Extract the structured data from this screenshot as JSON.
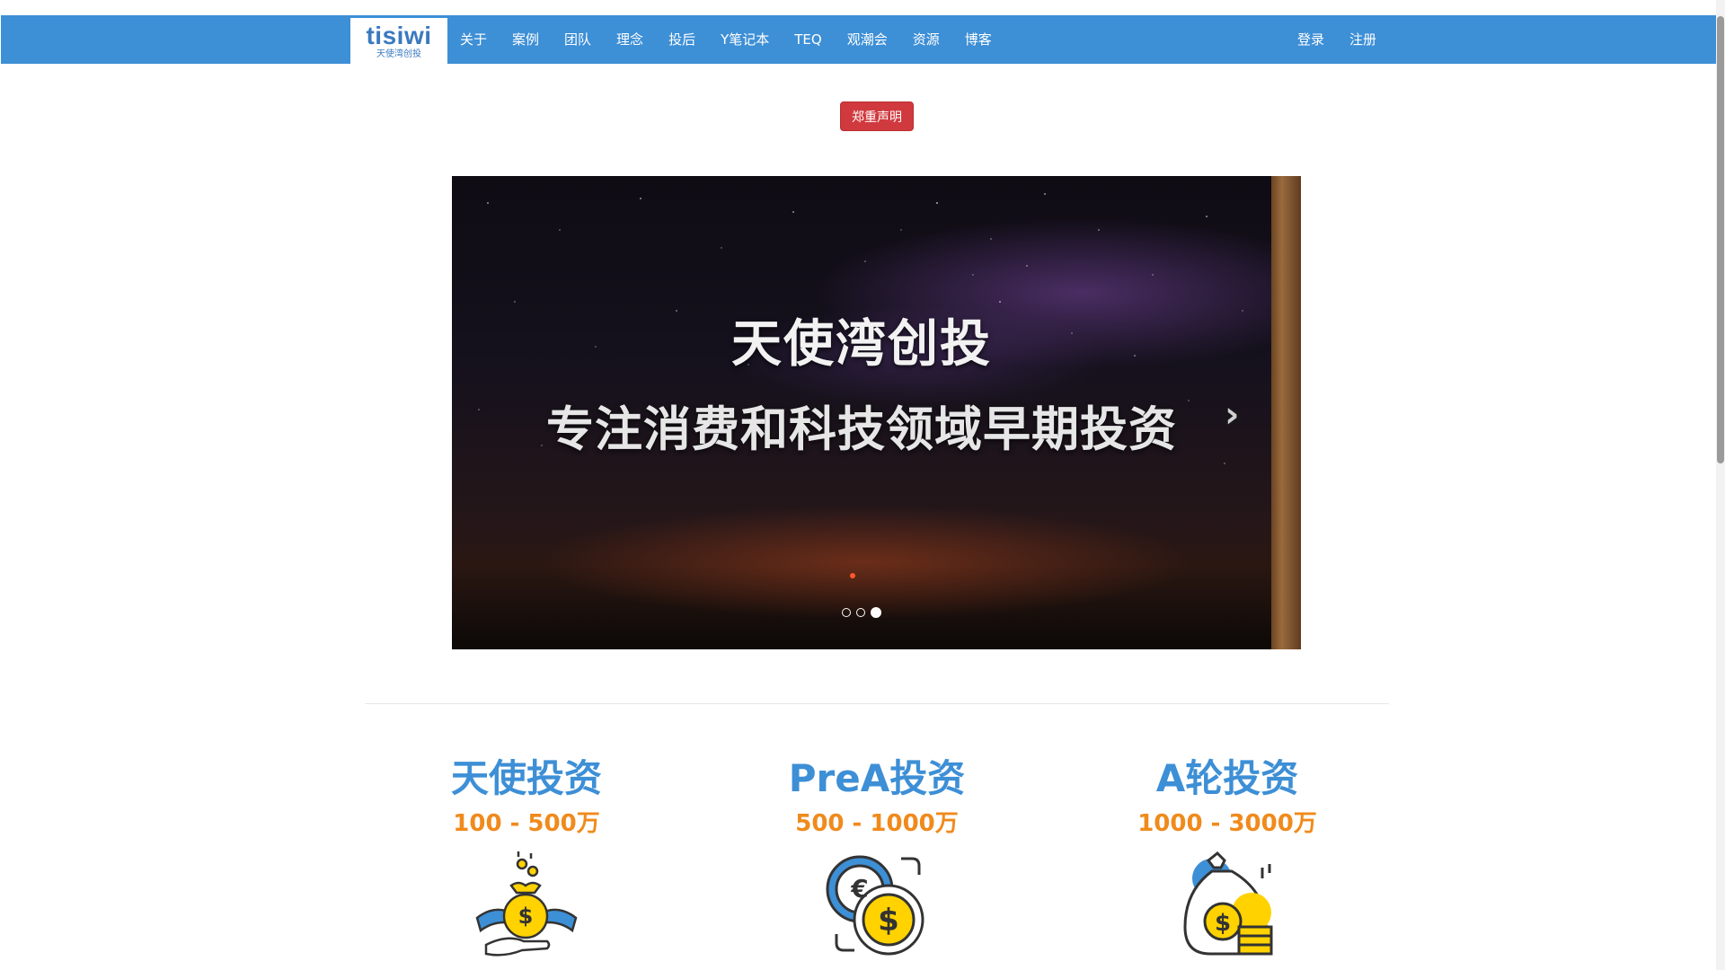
{
  "nav": {
    "logo_word": "tisiwi",
    "logo_sub": "天使湾创投",
    "links": [
      "关于",
      "案例",
      "团队",
      "理念",
      "投后",
      "Y笔记本",
      "TEQ",
      "观潮会",
      "资源",
      "博客"
    ],
    "login": "登录",
    "register": "注册",
    "brand_color": "#3d8fd6"
  },
  "notice": {
    "label": "郑重声明",
    "color": "#d0393e"
  },
  "carousel": {
    "title": "天使湾创投",
    "subtitle": "专注消费和科技领域早期投资",
    "next_label": "›",
    "slides_count": 3,
    "active_index": 2
  },
  "tiers": [
    {
      "title": "天使投资",
      "range": "100 - 500万",
      "icon": "angel-money-bag-icon"
    },
    {
      "title": "PreA投资",
      "range": "500 - 1000万",
      "icon": "coins-exchange-icon"
    },
    {
      "title": "A轮投资",
      "range": "1000 - 3000万",
      "icon": "money-bag-coins-icon"
    }
  ],
  "colors": {
    "title_blue": "#3d8fd6",
    "range_orange": "#f08a1c"
  }
}
